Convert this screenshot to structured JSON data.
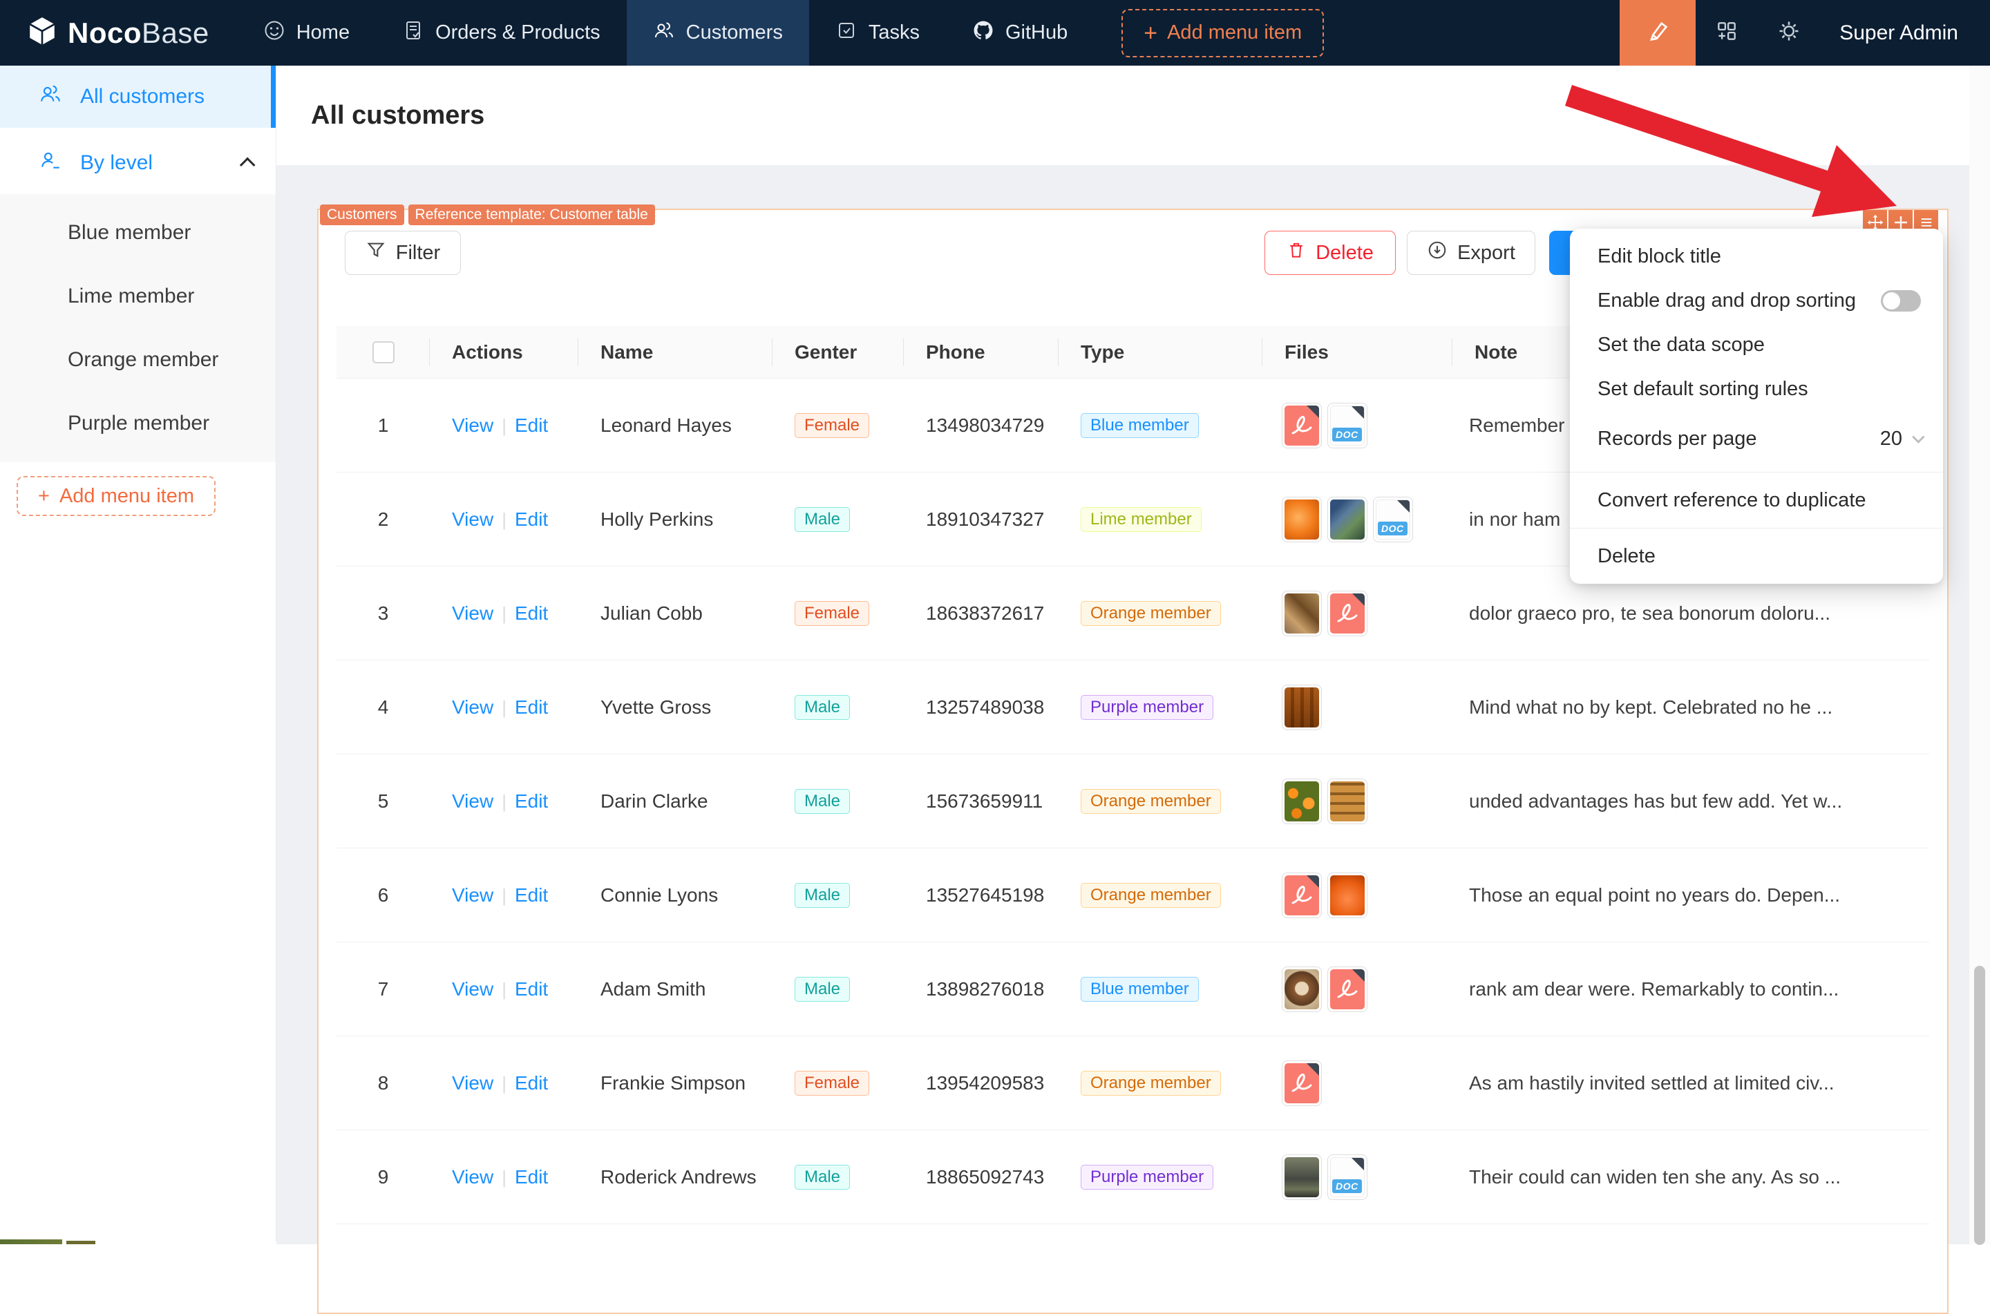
{
  "nav": {
    "logo_primary": "Noco",
    "logo_secondary": "Base",
    "items": [
      {
        "label": "Home"
      },
      {
        "label": "Orders & Products"
      },
      {
        "label": "Customers"
      },
      {
        "label": "Tasks"
      },
      {
        "label": "GitHub"
      }
    ],
    "add_menu_item_label": "Add menu item",
    "add_plus": "+",
    "user_label": "Super Admin"
  },
  "sidebar": {
    "all_customers_label": "All customers",
    "by_level_label": "By level",
    "level_items": [
      "Blue member",
      "Lime member",
      "Orange member",
      "Purple member"
    ],
    "add_menu_item_label": "Add menu item",
    "add_plus": "+"
  },
  "page": {
    "title": "All customers"
  },
  "block": {
    "tag_collection": "Customers",
    "tag_template": "Reference template: Customer table",
    "filter_label": "Filter",
    "delete_label": "Delete",
    "export_label": "Export",
    "add_label": "+"
  },
  "table": {
    "columns": [
      "Actions",
      "Name",
      "Genter",
      "Phone",
      "Type",
      "Files",
      "Note"
    ],
    "view_label": "View",
    "edit_label": "Edit",
    "doc_label": "DOC",
    "rows": [
      {
        "index": "1",
        "name": "Leonard Hayes",
        "gender": "Female",
        "phone": "13498034729",
        "type": "Blue member",
        "files": [
          {
            "kind": "pdf"
          },
          {
            "kind": "doc"
          }
        ],
        "note": "Remember"
      },
      {
        "index": "2",
        "name": "Holly Perkins",
        "gender": "Male",
        "phone": "18910347327",
        "type": "Lime member",
        "files": [
          {
            "kind": "img",
            "style": "fruit1"
          },
          {
            "kind": "img",
            "style": "plants"
          },
          {
            "kind": "doc"
          }
        ],
        "note": "in nor ham"
      },
      {
        "index": "3",
        "name": "Julian Cobb",
        "gender": "Female",
        "phone": "18638372617",
        "type": "Orange member",
        "files": [
          {
            "kind": "img",
            "style": "food"
          },
          {
            "kind": "pdf"
          }
        ],
        "note": "dolor graeco pro, te sea bonorum doloru..."
      },
      {
        "index": "4",
        "name": "Yvette Gross",
        "gender": "Male",
        "phone": "13257489038",
        "type": "Purple member",
        "files": [
          {
            "kind": "img",
            "style": "bread"
          }
        ],
        "note": "Mind what no by kept. Celebrated no he ..."
      },
      {
        "index": "5",
        "name": "Darin Clarke",
        "gender": "Male",
        "phone": "15673659911",
        "type": "Orange member",
        "files": [
          {
            "kind": "img",
            "style": "oranges"
          },
          {
            "kind": "img",
            "style": "pastry"
          }
        ],
        "note": "unded advantages has but few add. Yet w..."
      },
      {
        "index": "6",
        "name": "Connie Lyons",
        "gender": "Male",
        "phone": "13527645198",
        "type": "Orange member",
        "files": [
          {
            "kind": "pdf"
          },
          {
            "kind": "img",
            "style": "fruit2"
          }
        ],
        "note": "Those an equal point no years do. Depen..."
      },
      {
        "index": "7",
        "name": "Adam Smith",
        "gender": "Male",
        "phone": "13898276018",
        "type": "Blue member",
        "files": [
          {
            "kind": "img",
            "style": "coffee"
          },
          {
            "kind": "pdf"
          }
        ],
        "note": "rank am dear were. Remarkably to contin..."
      },
      {
        "index": "8",
        "name": "Frankie Simpson",
        "gender": "Female",
        "phone": "13954209583",
        "type": "Orange member",
        "files": [
          {
            "kind": "pdf"
          }
        ],
        "note": "As am hastily invited settled at limited civ..."
      },
      {
        "index": "9",
        "name": "Roderick Andrews",
        "gender": "Male",
        "phone": "18865092743",
        "type": "Purple member",
        "files": [
          {
            "kind": "img",
            "style": "shop"
          },
          {
            "kind": "doc"
          }
        ],
        "note": "Their could can widen ten she any. As so ..."
      }
    ]
  },
  "settings_menu": {
    "edit_block_title": "Edit block title",
    "enable_drag": "Enable drag and drop sorting",
    "set_data_scope": "Set the data scope",
    "set_sorting": "Set default sorting rules",
    "records_per_page": "Records per page",
    "records_value": "20",
    "convert": "Convert reference to duplicate",
    "delete": "Delete"
  },
  "colors": {
    "accent_orange": "#EC7D56",
    "primary_blue": "#1890ff",
    "arrow_red": "#e5232e",
    "navbar_bg": "#0c1e32",
    "tags": {
      "Female": {
        "bg": "#fff2e8",
        "border": "#ffbb96",
        "text": "#e04f22"
      },
      "Male": {
        "bg": "#e6fffb",
        "border": "#87e8de",
        "text": "#13a09b"
      },
      "Blue member": {
        "bg": "#e6f7ff",
        "border": "#91d5ff",
        "text": "#1890ff"
      },
      "Lime member": {
        "bg": "#fcffe6",
        "border": "#eaff8f",
        "text": "#9fb718"
      },
      "Orange member": {
        "bg": "#fff7e6",
        "border": "#ffd591",
        "text": "#d46b08"
      },
      "Purple member": {
        "bg": "#f9f0ff",
        "border": "#d3adf7",
        "text": "#722ed1"
      }
    }
  }
}
